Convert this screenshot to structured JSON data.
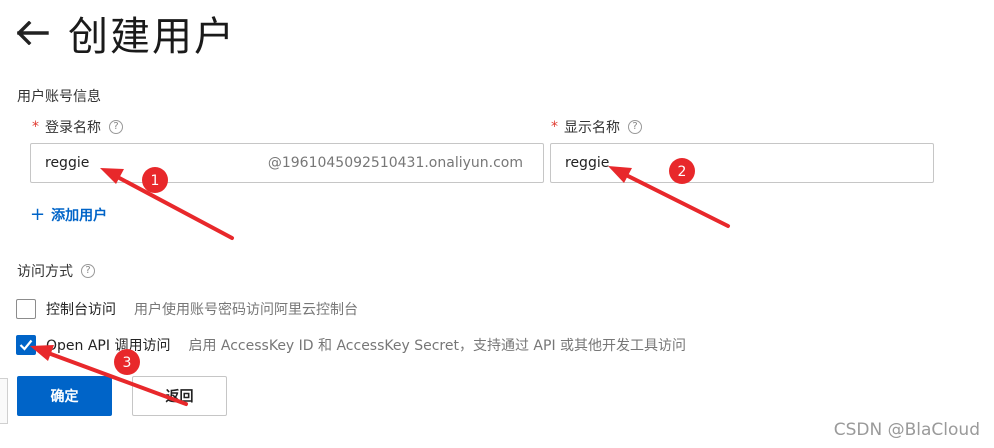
{
  "header": {
    "title": "创建用户",
    "back_icon": "arrow-left-icon"
  },
  "section": {
    "title": "用户账号信息"
  },
  "login_name": {
    "required_mark": "*",
    "label": "登录名称",
    "help": "?",
    "value": "reggie",
    "suffix": "@1961045092510431.onaliyun.com"
  },
  "display_name": {
    "required_mark": "*",
    "label": "显示名称",
    "help": "?",
    "value": "reggie"
  },
  "add_user": {
    "plus": "+",
    "label": "添加用户"
  },
  "access": {
    "label": "访问方式",
    "help": "?",
    "options": [
      {
        "label": "控制台访问",
        "desc": "用户使用账号密码访问阿里云控制台",
        "checked": false
      },
      {
        "label": "Open API 调用访问",
        "desc": "启用 AccessKey ID 和 AccessKey Secret，支持通过 API 或其他开发工具访问",
        "checked": true
      }
    ]
  },
  "buttons": {
    "confirm": "确定",
    "back": "返回"
  },
  "annotations": {
    "marker_color": "#e8282b",
    "markers": [
      "1",
      "2",
      "3"
    ]
  },
  "watermark": "CSDN @BlaCloud",
  "colors": {
    "primary": "#0064c8",
    "required": "#e03a2f"
  }
}
